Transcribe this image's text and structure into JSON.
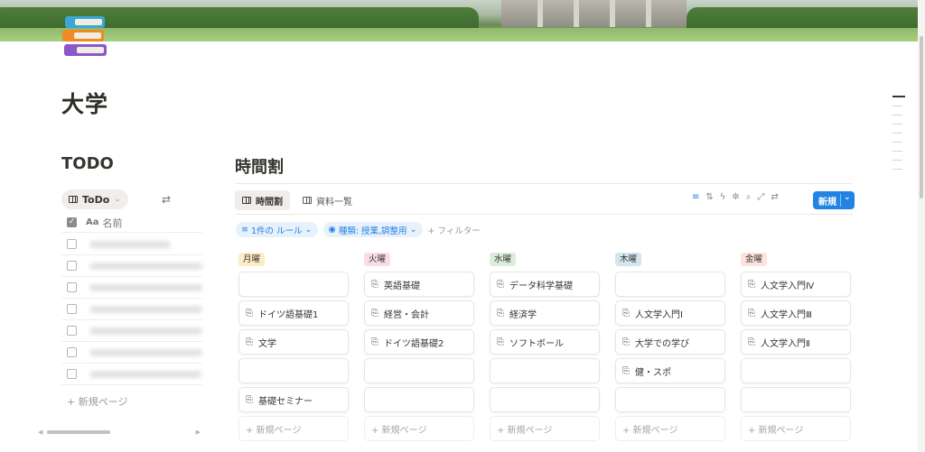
{
  "page": {
    "title": "大学"
  },
  "todo": {
    "title": "TODO",
    "view_label": "ToDo",
    "header_icon_text": "Aa",
    "name_header": "名前",
    "new_page": "+ 新規ページ"
  },
  "timetable": {
    "title": "時間割",
    "tabs": [
      {
        "label": "時間割"
      },
      {
        "label": "資料一覧"
      }
    ],
    "new_button": "新規",
    "filters": {
      "rule_chip": "1件の ルール",
      "type_chip": "種類: 授業,調整用",
      "add_filter": "+ フィルター"
    },
    "columns": [
      {
        "label": "月曜",
        "color": "#fdecc8",
        "cards": [
          "",
          "ドイツ語基礎1",
          "文学",
          "",
          "基礎セミナー"
        ],
        "new_page": "+ 新規ページ"
      },
      {
        "label": "火曜",
        "color": "#fadce8",
        "cards": [
          "英語基礎",
          "経営・会計",
          "ドイツ語基礎2",
          "",
          ""
        ],
        "new_page": "+ 新規ページ"
      },
      {
        "label": "水曜",
        "color": "#dbeddb",
        "cards": [
          "データ科学基礎",
          "経済学",
          "ソフトボール",
          "",
          ""
        ],
        "new_page": "+ 新規ページ"
      },
      {
        "label": "木曜",
        "color": "#d3e5ef",
        "cards": [
          "",
          "人文学入門Ⅰ",
          "大学での学び",
          "健・スポ",
          ""
        ],
        "new_page": "+ 新規ページ"
      },
      {
        "label": "金曜",
        "color": "#ffe2dd",
        "cards": [
          "人文学入門Ⅳ",
          "人文学入門Ⅲ",
          "人文学入門Ⅱ",
          "",
          ""
        ],
        "new_page": "+ 新規ページ"
      }
    ]
  }
}
